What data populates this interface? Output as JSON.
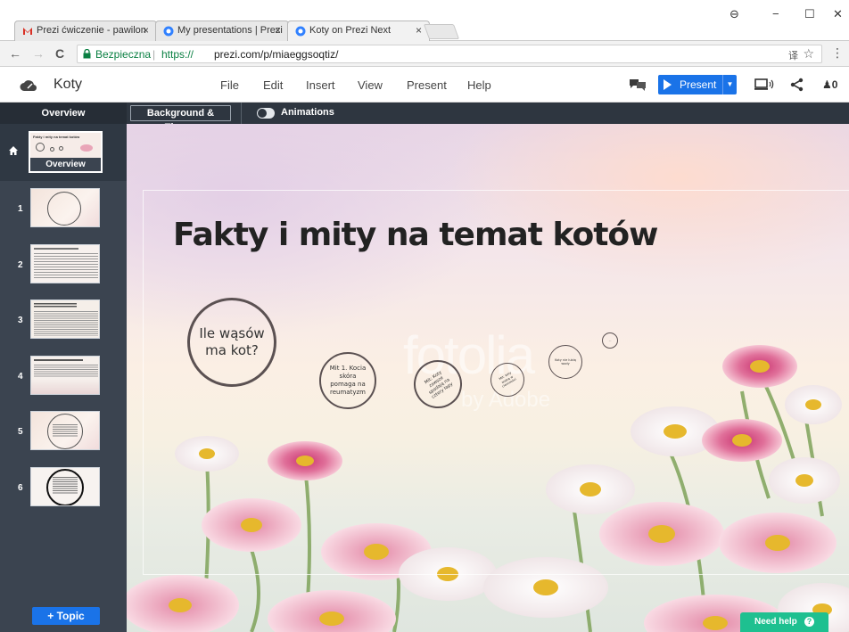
{
  "browser": {
    "tabs": [
      {
        "title": "Prezi ćwiczenie - pawilon",
        "icon": "gmail-icon"
      },
      {
        "title": "My presentations | Prezi",
        "icon": "prezi-icon"
      },
      {
        "title": "Koty on Prezi Next",
        "icon": "prezi-icon"
      }
    ],
    "close_glyph": "×",
    "address": {
      "secure_label": "Bezpieczna",
      "separator": "|",
      "url_scheme": "https://",
      "url_host": "prezi.com",
      "url_path": "/p/miaeggsoqtiz/"
    },
    "window_controls": {
      "profile": "⊖",
      "minimize": "−",
      "maximize": "☐",
      "close": "✕"
    },
    "nav": {
      "back": "←",
      "forward": "→",
      "reload": "C"
    },
    "translate_glyph": "译",
    "star_glyph": "☆",
    "kebab_glyph": "⋮"
  },
  "header": {
    "title": "Koty",
    "menu": [
      "File",
      "Edit",
      "Insert",
      "View",
      "Present",
      "Help"
    ],
    "present_label": "Present",
    "present_dropdown": "▼",
    "users_label": "0"
  },
  "toolbar": {
    "overview": "Overview",
    "background_theme": "Background & Theme",
    "animations": "Animations"
  },
  "sidebar": {
    "overview_thumb_title": "Fakty i mity na temat kotów",
    "overview_thumb_label": "Overview",
    "slides": [
      {
        "num": "1"
      },
      {
        "num": "2"
      },
      {
        "num": "3"
      },
      {
        "num": "4"
      },
      {
        "num": "5"
      },
      {
        "num": "6"
      }
    ],
    "topic_button": "+ Topic"
  },
  "canvas": {
    "title": "Fakty i mity na temat kotów",
    "watermark": "fotolia",
    "watermark_sub": "by Adobe",
    "topics": [
      {
        "label": "Ile wąsów ma kot?"
      },
      {
        "label": "Mit 1. Kocia skóra pomaga na reumatyzm"
      },
      {
        "label": "Mit: Koty zawsze spadają na cztery łapy"
      },
      {
        "label": "Mit: koty widzą w ciemności"
      },
      {
        "label": "Koty nie lubią wody"
      },
      {
        "label": "..."
      }
    ]
  },
  "help": {
    "label": "Need help",
    "icon_glyph": "?"
  },
  "colors": {
    "accent": "#1a73e8",
    "dark_panel": "#2e3640",
    "help": "#1ec090"
  }
}
